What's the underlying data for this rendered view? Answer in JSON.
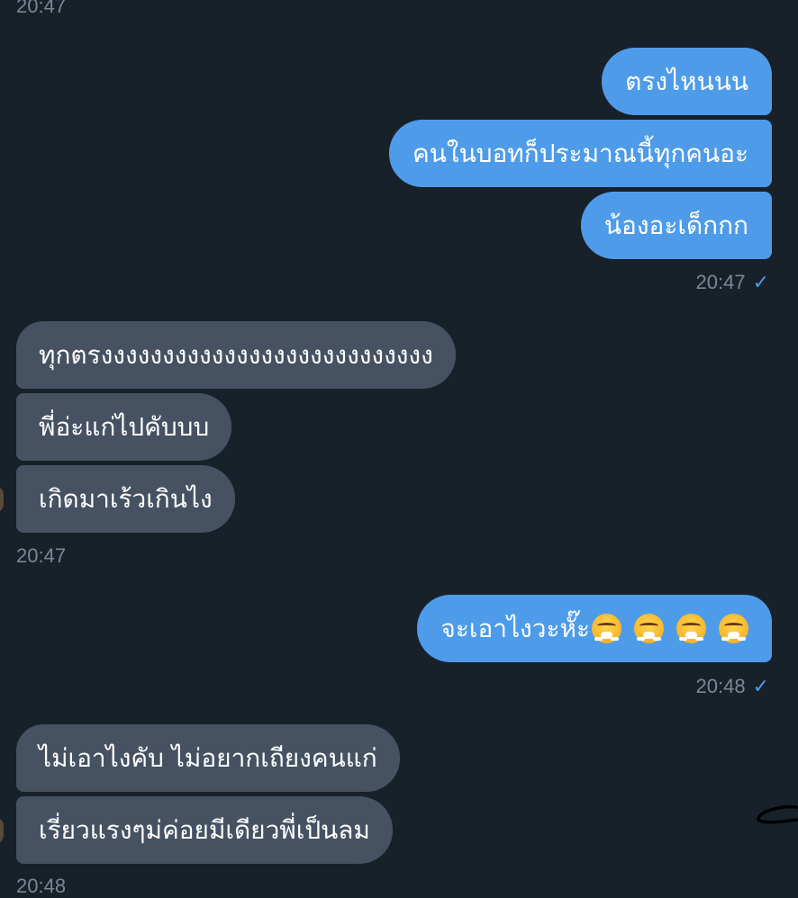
{
  "chat": {
    "top_time": "20:47",
    "group1": {
      "messages": [
        "ตรงไหนนน",
        "คนในบอทก็ประมาณนี้ทุกคนอะ",
        "น้องอะเด็กกก"
      ],
      "time": "20:47",
      "status_icon": "✓"
    },
    "group2": {
      "messages": [
        "ทุกตรงงงงงงงงงงงงงงงงงงงงงงงงงงง",
        "พี่อ่ะแก่ไปคับบบ",
        "เกิดมาเร้วเกินไง"
      ],
      "time": "20:47"
    },
    "group3": {
      "message": "จะเอาไงวะหั๊ะ",
      "emojis": [
        "face-with-steam-from-nose",
        "face-with-steam-from-nose",
        "face-with-steam-from-nose",
        "face-with-steam-from-nose"
      ],
      "time": "20:48",
      "status_icon": "✓"
    },
    "group4": {
      "messages": [
        "ไม่เอาไงคับ ไม่อยากเถียงคนแก่",
        "เรี่ยวแรงๆม่ค่อยมีเดียวพี่เป็นลม"
      ],
      "time": "20:48"
    }
  },
  "colors": {
    "background": "#18202a",
    "outgoing_bubble": "#4e9ce9",
    "incoming_bubble": "#465262",
    "timestamp": "#7d8793",
    "check": "#4a9be6"
  }
}
